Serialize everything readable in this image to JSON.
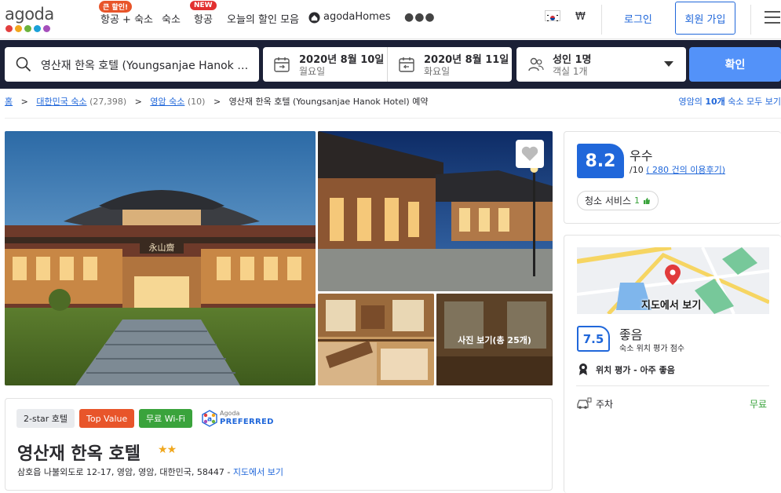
{
  "header": {
    "logo": "agoda",
    "logo_dot_colors": [
      "#e23f3f",
      "#f2a61c",
      "#6bb33c",
      "#1aa0d8",
      "#a54fbb"
    ],
    "nav": [
      {
        "label": "항공 + 숙소",
        "badge": "큰 할인!",
        "badge_color": "#e8552a"
      },
      {
        "label": "숙소"
      },
      {
        "label": "항공",
        "badge": "NEW",
        "badge_color": "#e23030"
      },
      {
        "label": "오늘의 할인 모음"
      },
      {
        "label": "agodaHomes",
        "icon": "agoda-homes-icon"
      }
    ],
    "more_icon": "more-dots-icon",
    "language_flag": "korea-flag-icon",
    "currency": "₩",
    "login": "로그인",
    "signup": "회원 가입",
    "menu_icon": "hamburger-menu-icon"
  },
  "search": {
    "destination": "영산재 한옥 호텔 (Youngsanjae Hanok Hotel)",
    "checkin": {
      "date": "2020년 8월 10일",
      "day": "월요일"
    },
    "checkout": {
      "date": "2020년 8월 11일",
      "day": "화요일"
    },
    "occupancy": {
      "guests": "성인 1명",
      "rooms": "객실 1개"
    },
    "confirm": "확인"
  },
  "breadcrumb": {
    "home": "홈",
    "country": "대한민국 숙소",
    "country_count": "(27,398)",
    "city": "영암 숙소",
    "city_count": "(10)",
    "current": "영산재 한옥 호텔 (Youngsanjae Hanok Hotel) 예약",
    "right_link_prefix": "영암의",
    "right_link_count": "10개",
    "right_link_suffix": "숙소 모두 보기"
  },
  "gallery": {
    "hanja_sign": "永山齋",
    "view_all_photos": "사진 보기(총 25개)"
  },
  "hotel": {
    "tags": [
      {
        "label": "2-star 호텔",
        "bg": "#e9ebee",
        "color": "#2a2a2e"
      },
      {
        "label": "Top Value",
        "bg": "#e8552a",
        "color": "#ffffff"
      },
      {
        "label": "무료 Wi-Fi",
        "bg": "#3aa33c",
        "color": "#ffffff"
      }
    ],
    "preferred_small": "Agoda",
    "preferred_big": "PREFERRED",
    "name": "영산재 한옥 호텔",
    "star_rating": 2,
    "address": "삼호읍 나불외도로 12-17, 영암, 영암, 대한민국, 58447 -",
    "map_link": "지도에서 보기"
  },
  "review": {
    "score": "8.2",
    "label": "우수",
    "out_of": "/10",
    "review_link": "( 280 건의 이용후기)",
    "chip_label": "청소 서비스",
    "chip_count": "1"
  },
  "location": {
    "map_button": "지도에서 보기",
    "score": "7.5",
    "label": "좋음",
    "sublabel": "숙소 위치 평가 점수",
    "badge_text": "위치 평가 - 아주 좋음",
    "parking_label": "주차",
    "parking_value": "무료"
  },
  "colors": {
    "brand_blue": "#2067da",
    "search_band": "#1b2036",
    "confirm_button": "#5392f9",
    "free_green": "#3aa33c"
  }
}
